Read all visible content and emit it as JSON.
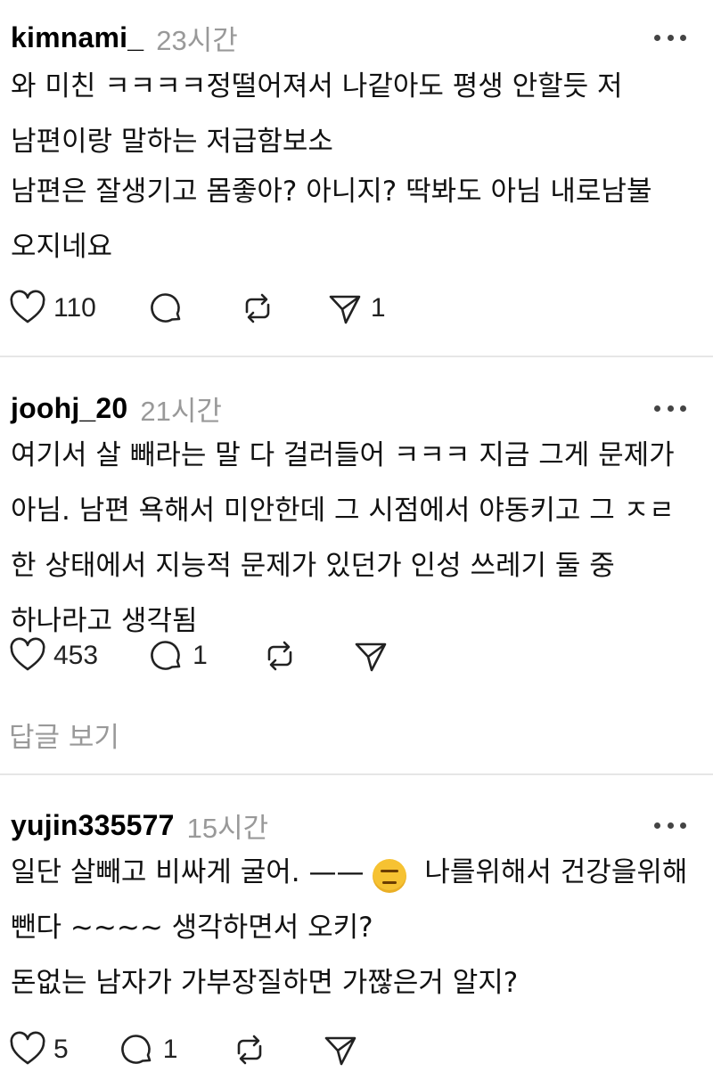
{
  "posts": [
    {
      "username": "kimnami_",
      "time": "23시간",
      "paragraphs": [
        "와 미친 ㅋㅋㅋㅋ정떨어져서 나같아도 평생 안할듯 저 남편이랑 말하는 저급함보소",
        "남편은 잘생기고 몸좋아? 아니지? 딱봐도 아님 내로남불 오지네요"
      ],
      "likes": "110",
      "replies": "",
      "reposts": "",
      "shares": "1"
    },
    {
      "username": "joohj_20",
      "time": "21시간",
      "paragraphs": [
        "여기서 살 빼라는 말 다 걸러들어 ㅋㅋㅋ 지금 그게 문제가 아님. 남편 욕해서 미안한데 그 시점에서 야동키고 그 ㅈㄹ 한 상태에서 지능적 문제가 있던가 인성 쓰레기 둘 중 하나라고 생각됨"
      ],
      "likes": "453",
      "replies": "1",
      "reposts": "",
      "shares": "",
      "view_replies": "답글 보기"
    },
    {
      "username": "yujin335577",
      "time": "15시간",
      "paragraph1_before_emoji": "일단 살빼고 비싸게 굴어.  ——",
      "emoji_name": "expressionless-face-emoji",
      "paragraph1_after_emoji": " 나를위해서 건강을위해 뺀다 ~~~~ 생각하면서 오키?",
      "paragraph2": "돈없는 남자가 가부장질하면 가짢은거 알지?",
      "likes": "5",
      "replies": "1",
      "reposts": "",
      "shares": ""
    }
  ],
  "icons": {
    "like": "heart-icon",
    "reply": "comment-bubble-icon",
    "repost": "repost-arrows-icon",
    "share": "send-paper-plane-icon",
    "more": "more-dots-icon"
  },
  "colors": {
    "text": "#111111",
    "muted": "#999999",
    "divider": "#e6e6e6",
    "icon": "#222222"
  }
}
